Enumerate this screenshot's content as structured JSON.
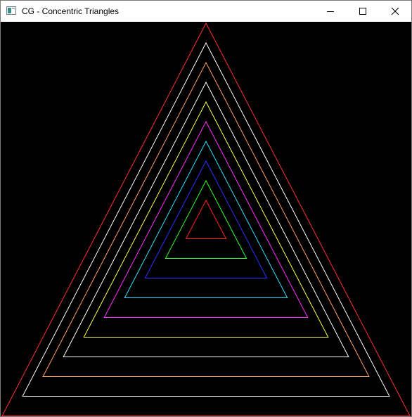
{
  "window": {
    "title": "CG - Concentric Triangles",
    "background": "#000000"
  },
  "title_bar": {
    "app_icon": "window-app-icon",
    "buttons": [
      {
        "name": "minimize-button",
        "icon": "minimize-icon"
      },
      {
        "name": "maximize-button",
        "icon": "maximize-icon"
      },
      {
        "name": "close-button",
        "icon": "close-icon"
      }
    ]
  },
  "scene": {
    "shape": "equilateral triangle outlines, concentric",
    "triangles": [
      {
        "index": 1,
        "color": "#ff3030"
      },
      {
        "index": 2,
        "color": "#ffffff"
      },
      {
        "index": 3,
        "color": "#ffa060"
      },
      {
        "index": 4,
        "color": "#ffffff"
      },
      {
        "index": 5,
        "color": "#ffff50"
      },
      {
        "index": 6,
        "color": "#ff30ff"
      },
      {
        "index": 7,
        "color": "#30e0ff"
      },
      {
        "index": 8,
        "color": "#3030ff"
      },
      {
        "index": 9,
        "color": "#30ff30"
      },
      {
        "index": 10,
        "color": "#ff2020"
      }
    ]
  }
}
